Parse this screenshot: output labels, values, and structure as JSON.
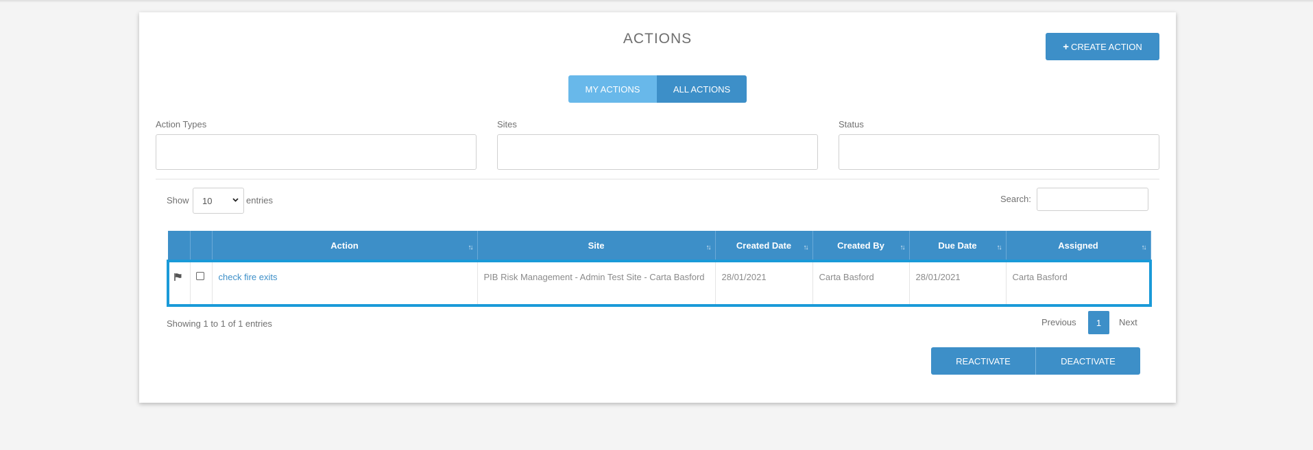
{
  "page": {
    "title": "ACTIONS",
    "create_button": "CREATE ACTION",
    "create_icon": "plus-icon"
  },
  "toggle": {
    "my_actions": "MY ACTIONS",
    "all_actions": "ALL ACTIONS"
  },
  "filters": {
    "action_types": "Action Types",
    "sites": "Sites",
    "status": "Status"
  },
  "table_controls": {
    "show": "Show",
    "length_value": "10",
    "entries": "entries",
    "search": "Search:"
  },
  "table": {
    "columns": [
      "",
      "",
      "Action",
      "Site",
      "Created Date",
      "Created By",
      "Due Date",
      "Assigned"
    ],
    "rows": [
      {
        "flag_icon": "flag-icon",
        "checked": false,
        "action": "check fire exits",
        "site": "PIB Risk Management - Admin Test Site - Carta Basford",
        "created_date": "28/01/2021",
        "created_by": "Carta Basford",
        "due_date": "28/01/2021",
        "assigned": "Carta Basford"
      }
    ]
  },
  "footer": {
    "info": "Showing 1 to 1 of 1 entries",
    "previous": "Previous",
    "page": "1",
    "next": "Next"
  },
  "actions": {
    "reactivate": "REACTIVATE",
    "deactivate": "DEACTIVATE"
  },
  "colors": {
    "primary": "#3d8fc8",
    "toggle_light": "#68b8ea",
    "selection_border": "#1a9ad8"
  }
}
